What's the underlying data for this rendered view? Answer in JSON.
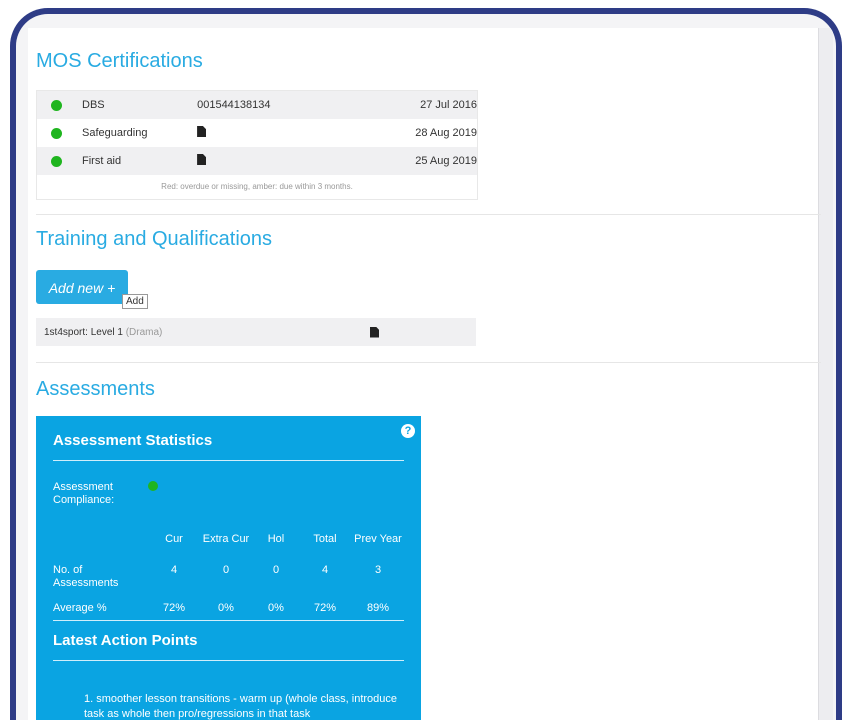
{
  "mos": {
    "title": "MOS Certifications",
    "rows": [
      {
        "name": "DBS",
        "number": "001544138134",
        "date": "27 Jul 2016",
        "status_color": "#1fb51f"
      },
      {
        "name": "Safeguarding",
        "number": "",
        "date": "28 Aug 2019",
        "status_color": "#1fb51f",
        "icon": "document-icon"
      },
      {
        "name": "First aid",
        "number": "",
        "date": "25 Aug 2019",
        "status_color": "#1fb51f",
        "icon": "document-icon"
      }
    ],
    "note": "Red: overdue or missing, amber: due within 3 months."
  },
  "training": {
    "title": "Training and Qualifications",
    "add_label": "Add new +",
    "tooltip": "Add",
    "items": [
      {
        "name": "1st4sport: Level 1",
        "category": "(Drama)",
        "icon": "document-icon"
      }
    ]
  },
  "assessments": {
    "title": "Assessments",
    "stats": {
      "title": "Assessment Statistics",
      "help": "?",
      "compliance_label": "Assessment Compliance:",
      "compliance_color": "#1fb51f",
      "columns": [
        "Cur",
        "Extra Cur",
        "Hol",
        "Total",
        "Prev Year"
      ],
      "rows": [
        {
          "label": "No. of Assessments",
          "values": [
            "4",
            "0",
            "0",
            "4",
            "3"
          ]
        },
        {
          "label": "Average %",
          "values": [
            "72%",
            "0%",
            "0%",
            "72%",
            "89%"
          ]
        }
      ]
    },
    "latest_title": "Latest Action Points",
    "action_points": "1. smoother lesson transitions - warm up (whole class, introduce task as whole then pro/regressions in that task"
  },
  "colors": {
    "accent": "#29abe2",
    "panel_blue": "#0aa4e2",
    "frame": "#2e3c86",
    "ok": "#1fb51f"
  }
}
